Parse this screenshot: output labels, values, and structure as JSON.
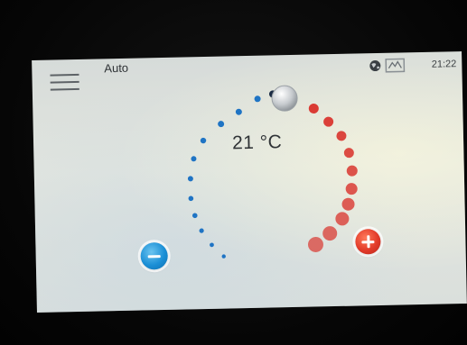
{
  "header": {
    "mode": "Auto",
    "time": "21:22",
    "icons": [
      "menu-icon",
      "globe-icon",
      "network-icon"
    ]
  },
  "dial": {
    "temperature": "21 °C",
    "cold_color": "#1f74c4",
    "warm_color": "#d9312a",
    "knob_color": "#d0d4d8"
  },
  "controls": {
    "decrease_icon": "minus-icon",
    "increase_icon": "plus-icon",
    "decrease_color": "#1b8fd6",
    "increase_color": "#e23b2a"
  }
}
